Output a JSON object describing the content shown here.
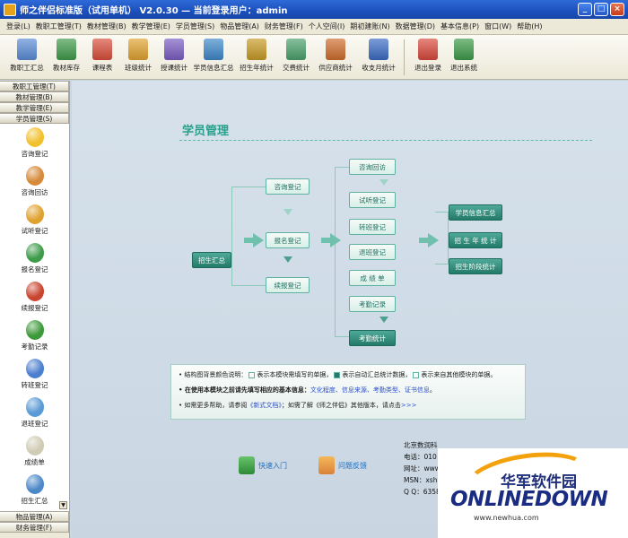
{
  "window": {
    "title": "师之伴侣标准版（试用单机） V2.0.30 — 当前登录用户：admin",
    "controls": [
      "_",
      "□",
      "×"
    ]
  },
  "menu": [
    "登录(L)",
    "教职工管理(T)",
    "教材管理(B)",
    "教学管理(E)",
    "学员管理(S)",
    "物品管理(A)",
    "财务管理(F)",
    "个人空间(I)",
    "期初建账(N)",
    "数据管理(D)",
    "基本信息(P)",
    "窗口(W)",
    "帮助(H)"
  ],
  "toolbar": [
    {
      "label": "教职工汇总",
      "icon": "staff-summary-icon",
      "color": "#5a8bd6"
    },
    {
      "label": "教材库存",
      "icon": "books-icon",
      "color": "#3f9a4a"
    },
    {
      "label": "课程表",
      "icon": "schedule-icon",
      "color": "#d94d3a"
    },
    {
      "label": "班级统计",
      "icon": "class-stats-icon",
      "color": "#e0a22e"
    },
    {
      "label": "授课统计",
      "icon": "teaching-stats-icon",
      "color": "#7a5cc2"
    },
    {
      "label": "学员信息汇总",
      "icon": "student-info-icon",
      "color": "#3d87c9"
    },
    {
      "label": "招生年统计",
      "icon": "enroll-stats-icon",
      "color": "#c79a24"
    },
    {
      "label": "交费统计",
      "icon": "payment-stats-icon",
      "color": "#4aa06b"
    },
    {
      "label": "供应商统计",
      "icon": "supplier-stats-icon",
      "color": "#cf6c2c"
    },
    {
      "label": "收支月统计",
      "icon": "monthly-stats-icon",
      "color": "#3a6bc4"
    }
  ],
  "toolbar_right": [
    {
      "label": "退出登录",
      "icon": "logout-icon",
      "color": "#d9483b"
    },
    {
      "label": "退出系统",
      "icon": "exit-system-icon",
      "color": "#3c9a47"
    }
  ],
  "sidebar": {
    "headers_top": [
      "教职工管理(T)",
      "教材管理(B)",
      "教学管理(E)",
      "学员管理(S)"
    ],
    "items": [
      {
        "label": "咨询登记",
        "icon": "lightbulb-icon",
        "color": "#f2c12e"
      },
      {
        "label": "咨询回访",
        "icon": "person-visit-icon",
        "color": "#d68a3a"
      },
      {
        "label": "试听登记",
        "icon": "audition-icon",
        "color": "#e0a22e"
      },
      {
        "label": "报名登记",
        "icon": "signup-icon",
        "color": "#3e9b4a"
      },
      {
        "label": "续报登记",
        "icon": "renew-icon",
        "color": "#c9452f"
      },
      {
        "label": "考勤记录",
        "icon": "clock-icon",
        "color": "#3d9a3a"
      },
      {
        "label": "转班登记",
        "icon": "transfer-icon",
        "color": "#4b7fcf"
      },
      {
        "label": "退班登记",
        "icon": "withdraw-icon",
        "color": "#5a9ad6"
      },
      {
        "label": "成绩单",
        "icon": "report-card-icon",
        "color": "#d0cbb5"
      },
      {
        "label": "招生汇总",
        "icon": "enroll-summary-icon",
        "color": "#4d89c8"
      }
    ],
    "headers_bottom": [
      "物品管理(A)",
      "财务管理(F)"
    ],
    "scroll_glyph": "▼"
  },
  "flow": {
    "title": "学员管理",
    "nodes": {
      "zixun_dengji": "咨询登记",
      "baoming_dengji": "报名登记",
      "xubao_dengji": "续报登记",
      "zhaosheng_huizong": "招生汇总",
      "zixun_huifang": "咨询回访",
      "shiting_dengji": "试听登记",
      "zhuanban_dengji": "转班登记",
      "tuiban_dengji": "退班登记",
      "chengji_dan": "成 绩 单",
      "kaoqin_jilu": "考勤记录",
      "kaoqin_tongji": "考勤统计",
      "xueyuan_xinxi_huizong": "学员信息汇总",
      "zhaosheng_nian_tongji": "招 生 年 统 计",
      "zhaosheng_jieduan_tongji": "招生阶段统计"
    }
  },
  "info": {
    "line1_prefix": "• 结构图背景颜色说明：",
    "line1_a": "表示本模块需填写的单据，",
    "line1_b": "表示自动汇总统计数据，",
    "line1_c": "表示来自其他模块的单据。",
    "line2_prefix": "• 在使用本模块之前请先填写相应的基本信息：",
    "line2_links": "文化程度、信息来源、考勤类型、证书信息",
    "line2_suffix": "。",
    "line3_prefix": "• 如需更多帮助，请参阅",
    "line3_link1": "《新式文档》",
    "line3_mid": "；如需了解《师之伴侣》其他版本，请点击",
    "line3_link2": ">>>"
  },
  "links": {
    "quick_start": "快速入门",
    "feedback": "问题反馈"
  },
  "company": {
    "line1": "北京数润科",
    "line2": "电话：010",
    "line3": "网址：www.",
    "line4": "MSN：xshl",
    "line5": "Q Q：6358"
  },
  "watermark": {
    "cn": "华军软件园",
    "logo": "ONLINEDOWN",
    "url": "www.newhua.com"
  }
}
